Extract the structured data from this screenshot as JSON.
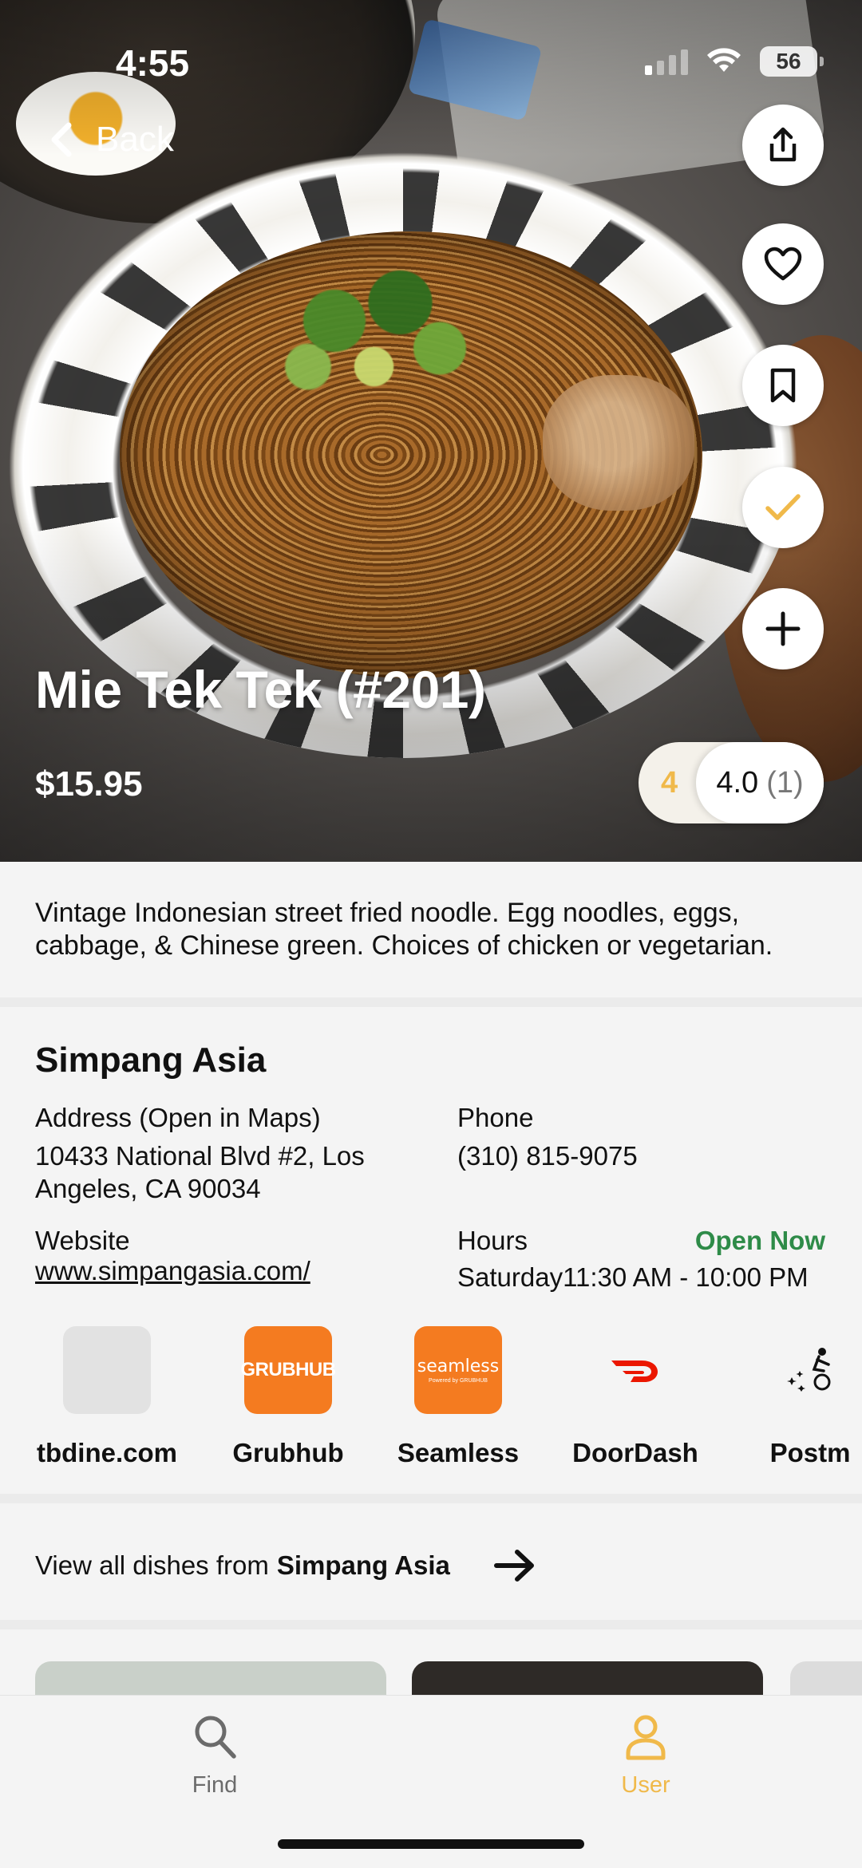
{
  "status_bar": {
    "time": "4:55",
    "battery": "56"
  },
  "nav": {
    "back_label": "Back"
  },
  "actions": {
    "share": "share-icon",
    "like": "heart-icon",
    "save": "bookmark-icon",
    "tried": "check-icon",
    "add": "plus-icon",
    "tried_color": "#f0b94a"
  },
  "dish": {
    "title": "Mie Tek Tek (#201)",
    "price": "$15.95",
    "user_rating": "4",
    "avg_rating": "4.0",
    "rating_count": "(1)",
    "description": "Vintage Indonesian street fried noodle. Egg noodles, eggs, cabbage, & Chinese green. Choices of chicken or vegetarian."
  },
  "restaurant": {
    "name": "Simpang Asia",
    "address_label": "Address (Open in Maps)",
    "address": "10433 National Blvd #2, Los Angeles, CA 90034",
    "phone_label": "Phone",
    "phone": "(310) 815-9075",
    "website_label": "Website",
    "website": "www.simpangasia.com/",
    "hours_label": "Hours",
    "open_status": "Open Now",
    "hours_day": "Saturday",
    "hours_time": "11:30 AM - 10:00 PM",
    "open_color": "#2e8b48"
  },
  "delivery": [
    {
      "name": "tbdine.com",
      "logo_text": "",
      "color": "#e2e2e2"
    },
    {
      "name": "Grubhub",
      "logo_text": "GRUBHUB",
      "color": "#f47b20"
    },
    {
      "name": "Seamless",
      "logo_text": "seamless",
      "logo_sub": "Powered by GRUBHUB",
      "color": "#f47b20"
    },
    {
      "name": "DoorDash",
      "logo_text": "",
      "color": "#eb1700"
    },
    {
      "name": "Postm",
      "logo_text": "",
      "color": "#111111"
    }
  ],
  "view_all": {
    "prefix": "View all dishes from",
    "restaurant": "Simpang Asia"
  },
  "tabbar": {
    "tabs": [
      {
        "label": "Find",
        "icon": "search-icon",
        "color": "#6b6b6b"
      },
      {
        "label": "User",
        "icon": "user-icon",
        "color": "#f0b94a"
      }
    ]
  }
}
